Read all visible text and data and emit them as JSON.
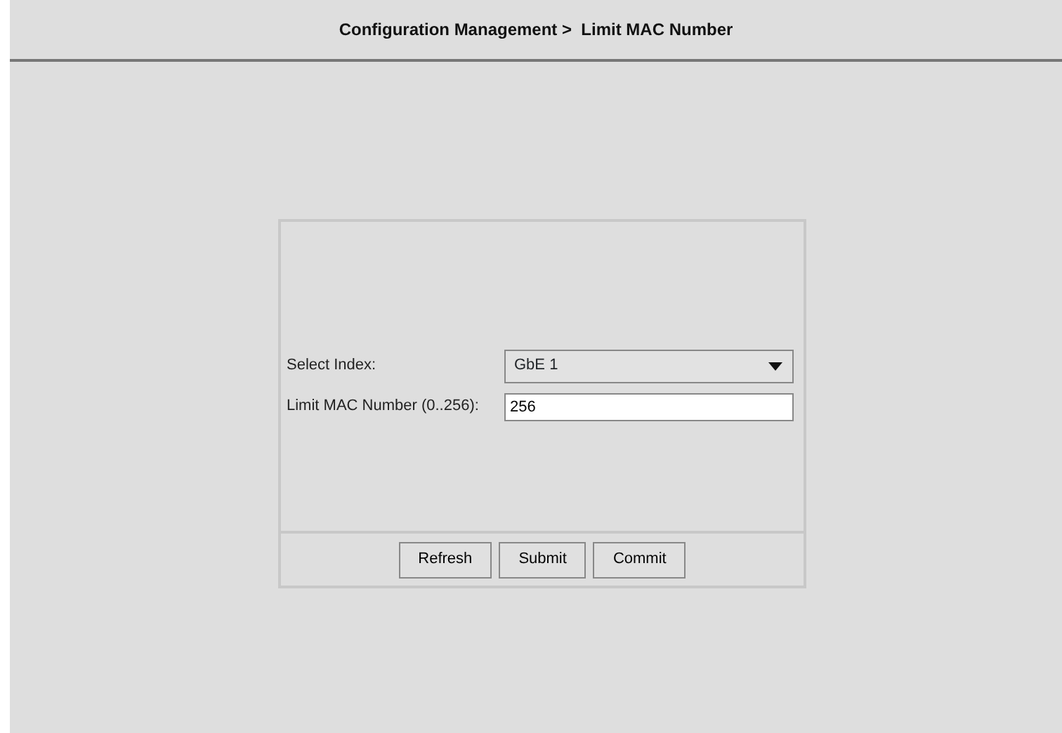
{
  "header": {
    "title": "Configuration Management >  Limit MAC Number"
  },
  "form": {
    "fields": [
      {
        "kind": "select",
        "label": "Select Index:",
        "value": "GbE 1"
      },
      {
        "kind": "text",
        "label": "Limit MAC Number (0..256):",
        "value": "256"
      }
    ],
    "buttons": [
      "Refresh",
      "Submit",
      "Commit"
    ]
  }
}
